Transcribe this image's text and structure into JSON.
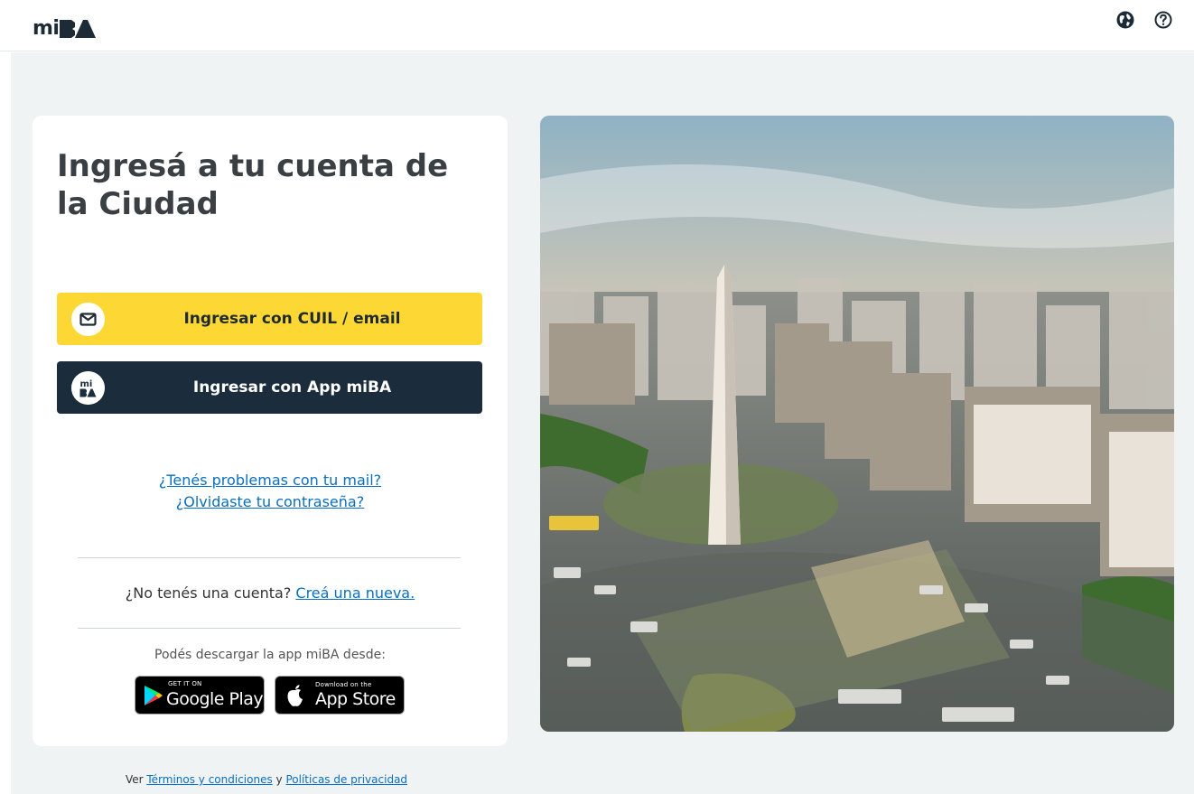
{
  "header": {
    "logo_text": "mi",
    "logo_mark": "BA",
    "icons": [
      "globe-icon",
      "help-circle-icon"
    ]
  },
  "login": {
    "title": "Ingresá a tu cuenta de la Ciudad",
    "btn_cuil_label": "Ingresar con CUIL / email",
    "btn_cuil_icon": "envelope-icon",
    "btn_app_label": "Ingresar con App miBA",
    "btn_app_icon": "miba-logo-icon",
    "link_mail_problem": "¿Tenés problemas con tu mail?",
    "link_forgot_password": "¿Olvidaste tu contraseña?",
    "no_account_text": "¿No tenés una cuenta?",
    "create_account_link": "Creá una nueva.",
    "download_text": "Podés descargar la app miBA desde:",
    "google_play_small": "GET IT ON",
    "google_play_big": "Google Play",
    "app_store_small": "Download on the",
    "app_store_big": "App Store"
  },
  "footer": {
    "prefix": "Ver",
    "terms_link": "Términos y condiciones",
    "connector": "y",
    "privacy_link": "Políticas de privacidad"
  },
  "colors": {
    "yellow_button": "#fdd835",
    "dark_button": "#1b2d3c",
    "link": "#0a6fc0",
    "page_background": "#f0f3f4"
  }
}
